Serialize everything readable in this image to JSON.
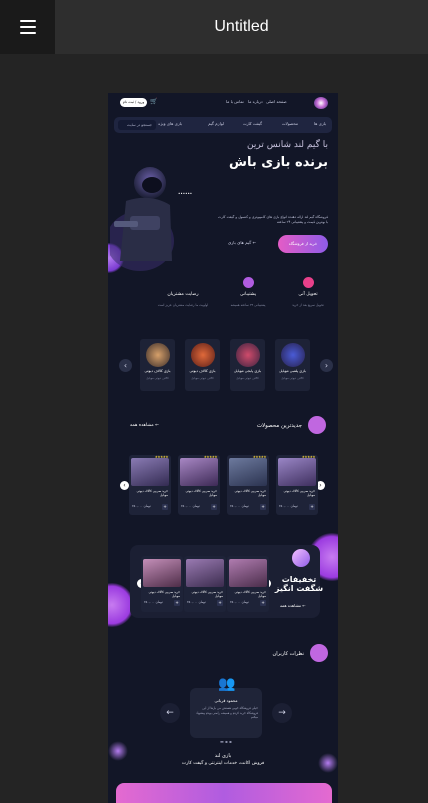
{
  "app": {
    "title": "Untitled",
    "menu_icon": "hamburger-icon"
  },
  "header": {
    "nav": [
      "صفحه اصلی",
      "درباره ما",
      "تماس با ما"
    ],
    "login_label": "ورود / ثبت نام",
    "cart_icon": "cart-icon",
    "categories": [
      "بازی ها",
      "محصولات",
      "گیفت کارت",
      "لوازم گیم",
      "بازی های ویژه"
    ],
    "search_placeholder": "جستجو در سایت"
  },
  "hero": {
    "subtitle": "با گیم لند شانس ترین",
    "title": "برنده بازی باش",
    "description": "فروشگاه گیم لند ارائه دهنده انواع بازی های کامپیوتری و کنسول و گیفت کارت با بهترین قیمت و پشتیبانی ۲۴ ساعته",
    "shop_button": "خرید از فروشگاه",
    "games_button": "گیم های بازی",
    "arrow_icon": "arrow-left-icon"
  },
  "features": [
    {
      "title": "تحویل آنی",
      "desc": "تحویل سریع بعد از خرید",
      "color": "#e8408a"
    },
    {
      "title": "پشتیبانی",
      "desc": "پشتیبانی ۲۴ ساعته همیشه",
      "color": "#b05ce0"
    },
    {
      "title": "رضایت مشتریان",
      "desc": "اولویت ما رضایت مشتریان عزیز است",
      "color": "#e45cc6"
    }
  ],
  "games": [
    {
      "title": "بازی پلمبی موبایل",
      "sub": "کالاف دیوتی موبایل"
    },
    {
      "title": "بازی پابجی موبایل",
      "sub": "کالاف دیوتی موبایل"
    },
    {
      "title": "بازی کالاف دیوتی",
      "sub": "کالاف دیوتی موبایل"
    },
    {
      "title": "بازی کالاف دیوتی",
      "sub": "کالاف دیوتی موبایل"
    }
  ],
  "products": {
    "title": "جدیدترین محصولات",
    "see_all": "مشاهده همه",
    "items": [
      {
        "name": "خرید سی‌پی کالاف دیوتی موبایل",
        "price": "۲۵۰,۰۰۰ تومان",
        "stars": "★★★★★"
      },
      {
        "name": "خرید سی‌پی کالاف دیوتی موبایل",
        "price": "۲۵۰,۰۰۰ تومان",
        "stars": "★★★★★"
      },
      {
        "name": "خرید سی‌پی کالاف دیوتی موبایل",
        "price": "۲۵۰,۰۰۰ تومان",
        "stars": "★★★★★"
      },
      {
        "name": "خرید سی‌پی کالاف دیوتی موبایل",
        "price": "۲۵۰,۰۰۰ تومان",
        "stars": "★★★★★"
      }
    ]
  },
  "discounts": {
    "title": "تخفیفات شگفت انگیز",
    "see_all": "مشاهده همه",
    "items": [
      {
        "name": "خرید سی‌پی کالاف دیوتی موبایل",
        "price": "۲۵۰,۰۰۰ تومان"
      },
      {
        "name": "خرید سی‌پی کالاف دیوتی موبایل",
        "price": "۲۵۰,۰۰۰ تومان"
      },
      {
        "name": "خرید سی‌پی کالاف دیوتی موبایل",
        "price": "۲۵۰,۰۰۰ تومان"
      }
    ]
  },
  "reviews": {
    "title": "نظرات کاربران",
    "reviewer": "محمود قربانی",
    "text": "خیلی فروشگاه خوبی هستش من بارها از این فروشگاه خرید کردم و همیشه راضی بودم پیشنهاد میکنم"
  },
  "footer": {
    "brand": "بازی لند",
    "tagline": "فروش اکانت، خدمات اینترنتی و گیفت کارت"
  }
}
